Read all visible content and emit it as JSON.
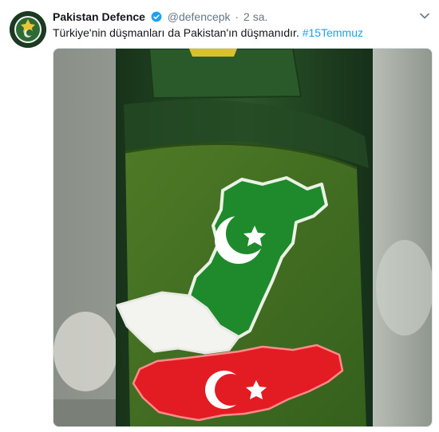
{
  "tweet": {
    "author_name": "Pakistan Defence",
    "handle": "@defencepk",
    "separator": "·",
    "time": "2 sa.",
    "text": "Türkiye'nin düşmanları da Pakistan'ın düşmanıdır. ",
    "hashtag": "#15Temmuz",
    "icons": {
      "verified": "verified-badge-icon",
      "caret": "chevron-down-icon",
      "avatar": "pakistan-defence-emblem"
    },
    "media_description_icon": "uniform-sleeve-flag-patches-photo"
  },
  "colors": {
    "hashtag": "#1da1f2",
    "verified": "#1da1f2",
    "name": "#14171a",
    "muted": "#657786",
    "pakistan_green": "#1f7a2a",
    "turkey_red": "#e11c23"
  }
}
